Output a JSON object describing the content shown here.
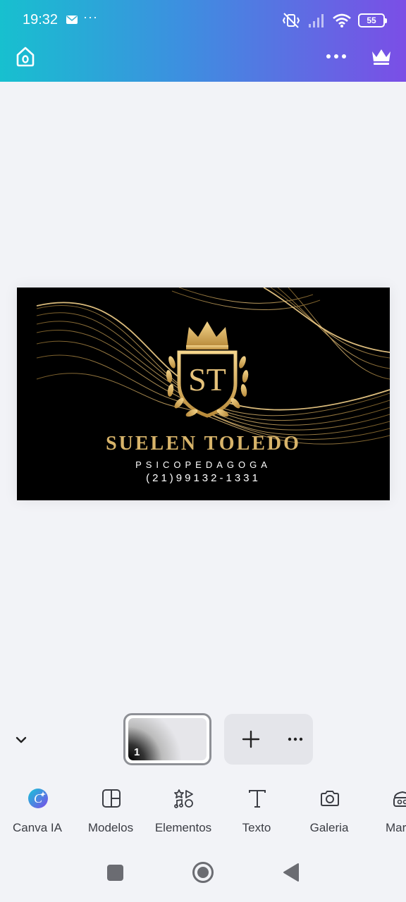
{
  "status": {
    "time": "19:32",
    "notification_dots": "···",
    "battery": "55"
  },
  "header": {
    "home_icon": "home-icon",
    "more_icon": "more-horizontal-icon",
    "premium_icon": "crown-icon"
  },
  "design": {
    "name": "SUELEN TOLEDO",
    "role": "PSICOPEDAGOGA",
    "phone": "(21)99132-1331",
    "monogram": "ST",
    "colors": {
      "gold": "#d8b46a",
      "background": "#000000"
    }
  },
  "pages": {
    "current_page": "1",
    "add_icon": "plus-icon",
    "more_icon": "more-horizontal-icon"
  },
  "toolbar": {
    "items": [
      {
        "label": "Canva IA",
        "icon": "canva-ai-icon"
      },
      {
        "label": "Modelos",
        "icon": "templates-icon"
      },
      {
        "label": "Elementos",
        "icon": "elements-icon"
      },
      {
        "label": "Texto",
        "icon": "text-icon"
      },
      {
        "label": "Galeria",
        "icon": "camera-icon"
      },
      {
        "label": "Mar",
        "icon": "brand-icon"
      }
    ]
  }
}
